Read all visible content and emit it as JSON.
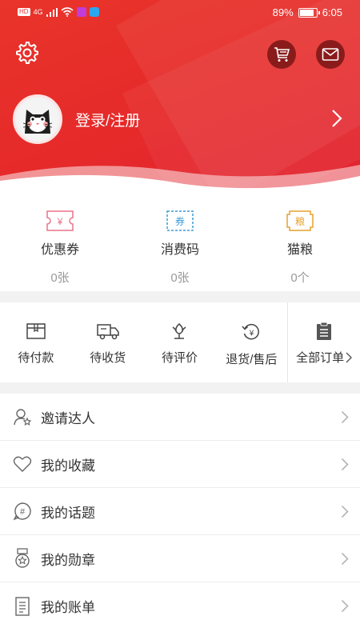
{
  "status_bar": {
    "signal_label": "4G",
    "battery": "89%",
    "time": "6:05"
  },
  "header": {
    "login_text": "登录/注册"
  },
  "assets": [
    {
      "label": "优惠券",
      "value": "0张",
      "badge": "¥",
      "color": "#e9748a"
    },
    {
      "label": "消费码",
      "value": "0张",
      "badge": "券",
      "color": "#3b9bd6"
    },
    {
      "label": "猫粮",
      "value": "0个",
      "badge": "粮",
      "color": "#e6a12f"
    }
  ],
  "orders": [
    {
      "label": "待付款",
      "icon": "wallet-icon"
    },
    {
      "label": "待收货",
      "icon": "truck-icon"
    },
    {
      "label": "待评价",
      "icon": "flower-icon"
    },
    {
      "label": "退货/售后",
      "icon": "refund-icon"
    },
    {
      "label": "全部订单",
      "icon": "clipboard-icon"
    }
  ],
  "menu": [
    {
      "label": "邀请达人",
      "icon": "invite-icon"
    },
    {
      "label": "我的收藏",
      "icon": "heart-icon"
    },
    {
      "label": "我的话题",
      "icon": "topic-icon"
    },
    {
      "label": "我的勋章",
      "icon": "medal-icon"
    },
    {
      "label": "我的账单",
      "icon": "bill-icon"
    }
  ],
  "colors": {
    "brand_red": "#e62a2a",
    "text": "#333333",
    "muted": "#999999"
  }
}
